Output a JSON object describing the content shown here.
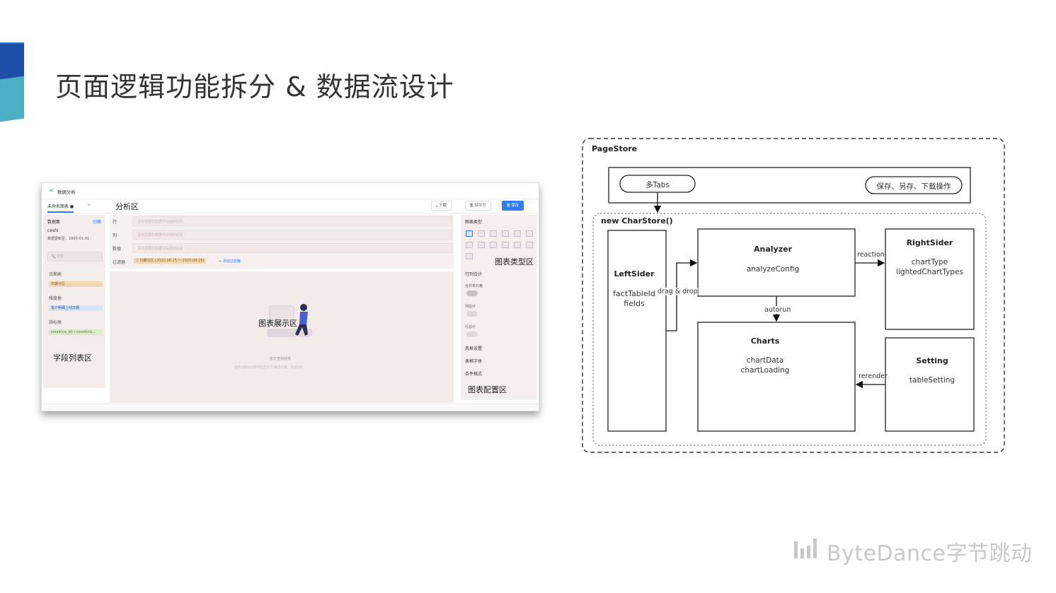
{
  "slide_title": "页面逻辑功能拆分 & 数据流设计",
  "screenshot": {
    "topbar_back": "<",
    "topbar_title": "数据分析",
    "tab_label": "未命名图表 ●",
    "tab_add": "+",
    "buttons": {
      "download": "⤓ 下载",
      "save_as": "🗎 另存为",
      "save": "🗎 保存"
    },
    "left": {
      "dataset_label": "数据集",
      "switch_label": "切换",
      "dataset_name": "ceshi",
      "dataset_updated": "数据更新至：1900-01-01",
      "search_placeholder": "🔍 搜索",
      "group_date": "日期类",
      "chip_date": "日期分区",
      "group_dim": "维度类",
      "chip_dim": "客户明细上线日期",
      "group_metric": "指标类",
      "chip_metric": "count(us_id) / count(co..."
    },
    "center": {
      "row_label": "行",
      "col_label": "列",
      "value_label": "数值",
      "filter_label": "过滤器",
      "placeholder": "请将需要的数据字段拖到此处",
      "filter_chip": "▽ 日期分区 (2020-08-15 ~ 2020-08-15)",
      "add_filter": "+ 添加过滤器",
      "empty_title": "暂无查询结果",
      "empty_desc": "请尝试拖动左侧字段至行/列/数值位置，开始分析"
    },
    "right": {
      "chart_type_label": "图表类型",
      "row_col_total": "行列合计",
      "merge_cells": "合并单元格",
      "col_total": "列总计",
      "row_total": "行总计",
      "style_settings": "风格设置",
      "table_font": "表格字体",
      "conditional_format": "条件格式"
    },
    "annotations": {
      "analysis_area": "分析区",
      "chart_type_area": "图表类型区",
      "chart_display_area": "图表展示区",
      "field_list_area": "字段列表区",
      "chart_config_area": "图表配置区"
    }
  },
  "diagram": {
    "page_store": "PageStore",
    "tabs": "多Tabs",
    "save_ops": "保存、另存、下载操作",
    "new_charstore": "new CharStore()",
    "leftsider": {
      "title": "LeftSider",
      "fields": [
        "factTableId",
        "fields"
      ]
    },
    "analyzer": {
      "title": "Analyzer",
      "fields": [
        "analyzeConfig"
      ]
    },
    "rightsider": {
      "title": "RightSider",
      "fields": [
        "chartType",
        "lightedChartTypes"
      ]
    },
    "charts": {
      "title": "Charts",
      "fields": [
        "chartData",
        "chartLoading"
      ]
    },
    "setting": {
      "title": "Setting",
      "fields": [
        "tableSetting"
      ]
    },
    "edges": {
      "drag_drop": "drag & drop",
      "reaction": "reaction",
      "autorun": "autorun",
      "rerender": "rerender"
    }
  },
  "brand": "ByteDance字节跳动",
  "colors": {
    "accent_dark": "#1d4fa8",
    "accent_light": "#4bb0c4",
    "primary_blue": "#2f7cf6"
  }
}
